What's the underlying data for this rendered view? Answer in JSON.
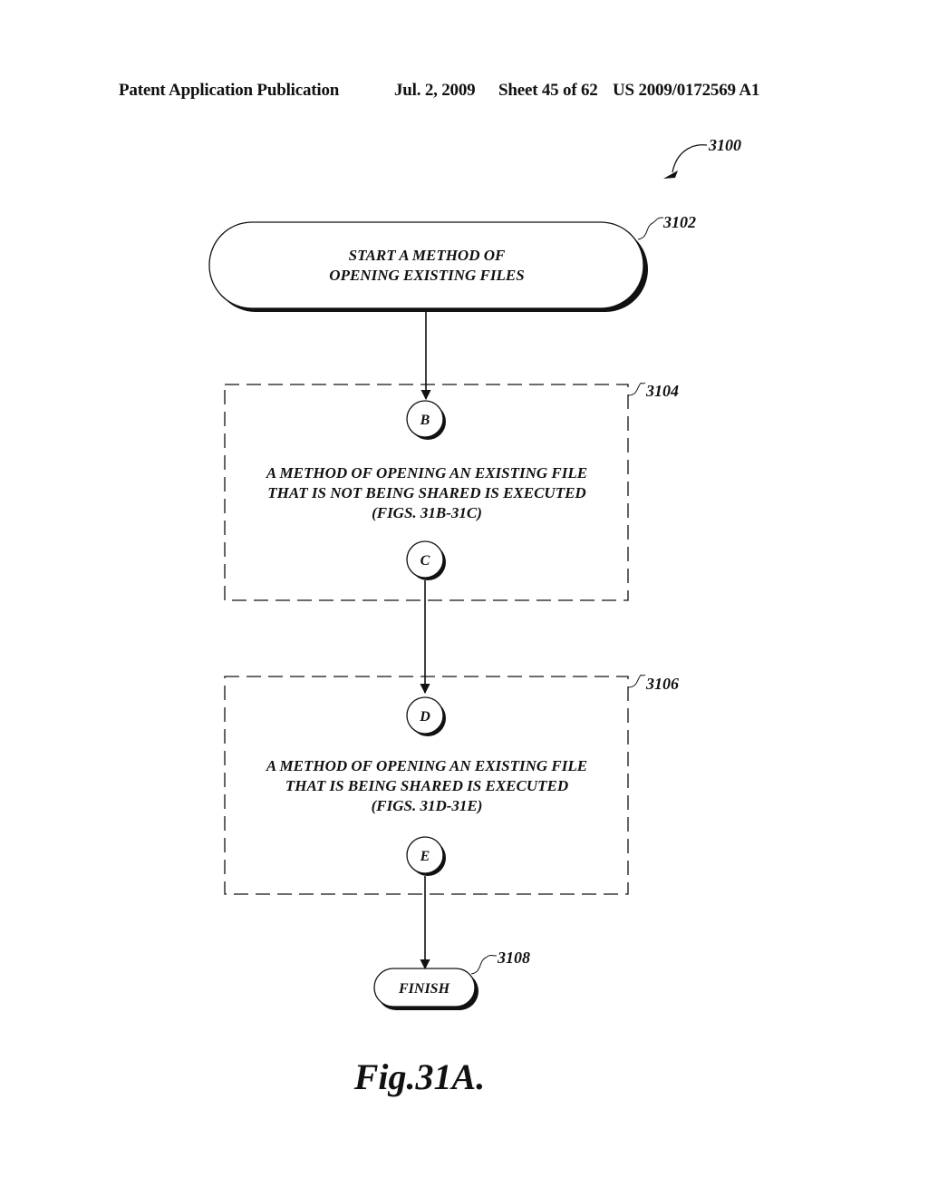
{
  "header": {
    "publication": "Patent Application Publication",
    "date": "Jul. 2, 2009",
    "sheet": "Sheet 45 of 62",
    "patent_number": "US 2009/0172569 A1"
  },
  "diagram": {
    "figure_ref": "3100",
    "start": {
      "ref": "3102",
      "lines": [
        "START A METHOD OF",
        "OPENING EXISTING FILES"
      ]
    },
    "step_not_shared": {
      "ref": "3104",
      "entry_connector": "B",
      "exit_connector": "C",
      "lines": [
        "A METHOD OF OPENING AN EXISTING FILE",
        "THAT IS NOT BEING SHARED IS EXECUTED",
        "(FIGS. 31B-31C)"
      ]
    },
    "step_shared": {
      "ref": "3106",
      "entry_connector": "D",
      "exit_connector": "E",
      "lines": [
        "A METHOD OF OPENING AN EXISTING FILE",
        "THAT IS BEING SHARED  IS EXECUTED",
        "(FIGS. 31D-31E)"
      ]
    },
    "finish": {
      "ref": "3108",
      "label": "FINISH"
    },
    "caption": "Fig.31A."
  }
}
